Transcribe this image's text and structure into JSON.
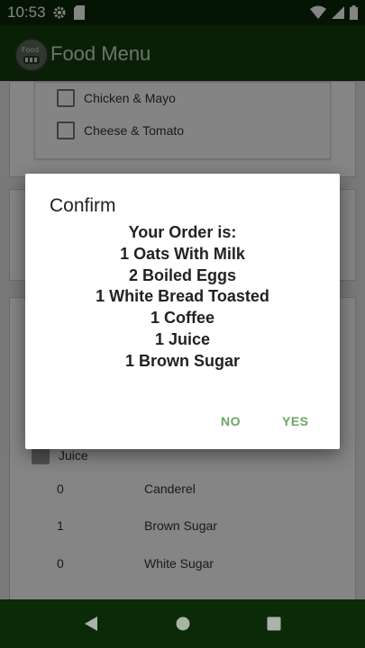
{
  "status_bar": {
    "time": "10:53"
  },
  "app_bar": {
    "title": "Food Menu",
    "logo_text": "Food"
  },
  "background": {
    "options_top": [
      {
        "label": "Chicken & Mayo",
        "checked": false
      },
      {
        "label": "Cheese & Tomato",
        "checked": false
      }
    ],
    "checked_item": {
      "label": "Juice"
    },
    "sweeteners": [
      {
        "qty": "0",
        "label": "Canderel"
      },
      {
        "qty": "1",
        "label": "Brown Sugar"
      },
      {
        "qty": "0",
        "label": "White Sugar"
      }
    ]
  },
  "dialog": {
    "title": "Confirm",
    "message_lines": [
      "Your Order is:",
      "1 Oats With Milk",
      "2 Boiled Eggs",
      "1 White Bread Toasted",
      "1 Coffee",
      "1 Juice",
      "1 Brown Sugar"
    ],
    "no_label": "NO",
    "yes_label": "YES"
  },
  "colors": {
    "app_bar": "#123f0d",
    "status_bar": "#0b2a08",
    "dialog_button": "#6aa765"
  }
}
